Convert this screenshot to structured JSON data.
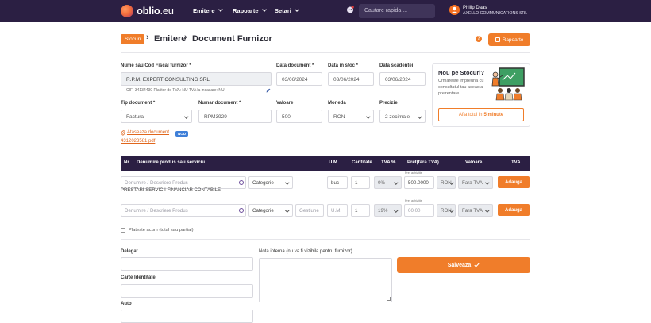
{
  "brand": {
    "name": "oblio",
    "tld": ".eu"
  },
  "nav": [
    {
      "label": "Emitere"
    },
    {
      "label": "Rapoarte"
    },
    {
      "label": "Setari"
    }
  ],
  "search": {
    "placeholder": "Cautare rapida ..."
  },
  "user": {
    "name": "Philip Daas",
    "company": "AXELLO COMMUNICATIONS SRL"
  },
  "breadcrumb": {
    "badge": "Stocuri",
    "parent": "Emitere",
    "separator": "›",
    "current": "Document Furnizor"
  },
  "header": {
    "help": "?",
    "reports_button": "Rapoarte"
  },
  "form": {
    "supplier_label": "Nume sau Cod Fiscal furnizor *",
    "supplier_value": "R.P.M. EXPERT CONSULTING SRL",
    "supplier_info": "CIF: 34134430   Platitor de TVA: NU   TVA la incasare: NU",
    "doc_date_label": "Data document *",
    "doc_date_value": "03/06/2024",
    "stock_date_label": "Data in stoc *",
    "stock_date_value": "03/06/2024",
    "due_date_label": "Data scadentei",
    "due_date_value": "03/06/2024",
    "doc_type_label": "Tip document *",
    "doc_type_value": "Factura",
    "doc_number_label": "Numar document *",
    "doc_number_value": "RPM3929",
    "value_label": "Valoare",
    "value_value": "500",
    "currency_label": "Moneda",
    "currency_value": "RON",
    "precision_label": "Precizie",
    "precision_value": "2 zecimale",
    "attach_link": "Ataseaza document",
    "new_badge": "NOU",
    "attached_file": "4312023581.pdf"
  },
  "info_card": {
    "title": "Nou pe Stocuri?",
    "description": "Urmareste impreuna cu consultatul tau aceasta prezentare.",
    "button_prefix": "Afla totul in",
    "button_bold": "5 minute"
  },
  "table": {
    "headers": {
      "nr": "Nr.",
      "product": "Denumire produs sau serviciu",
      "um": "U.M.",
      "qty": "Cantitate",
      "vat_pct": "TVA %",
      "price": "Pret(fara TVA)",
      "value": "Valoare",
      "vat": "TVA"
    },
    "rows": [
      {
        "product_placeholder": "Denumire / Descriere Produs",
        "category": "Categorie",
        "um": "buc",
        "qty": "1",
        "vat_pct": "0%",
        "price_hint": "Pret achizitie",
        "price": "500.0000",
        "currency": "RON",
        "vat_mode": "Fara TVA",
        "add_label": "Adauga",
        "subtext": "PRESTARI SERVICII FINANCIAR CONTABILE"
      },
      {
        "product_placeholder": "Denumire / Descriere Produs",
        "category": "Categorie",
        "warehouse_placeholder": "Gestiune",
        "um_placeholder": "U.M.",
        "qty": "1",
        "vat_pct": "19%",
        "price_hint": "Pret achizitie",
        "price_placeholder": "00.00",
        "currency": "RON",
        "vat_mode": "Fara TVA",
        "add_label": "Adauga"
      }
    ]
  },
  "payment_checkbox_label": "Plateste acum (total sau partial)",
  "bottom": {
    "delegate_label": "Delegat",
    "id_card_label": "Carte Identitate",
    "auto_label": "Auto",
    "internal_note_label": "Nota interna (nu va fi vizibila pentru furnizor)",
    "save_button": "Salveaza"
  },
  "colors": {
    "topbar": "#2b1f43",
    "accent": "#f07d2a",
    "badge_blue": "#3e7fd8"
  }
}
